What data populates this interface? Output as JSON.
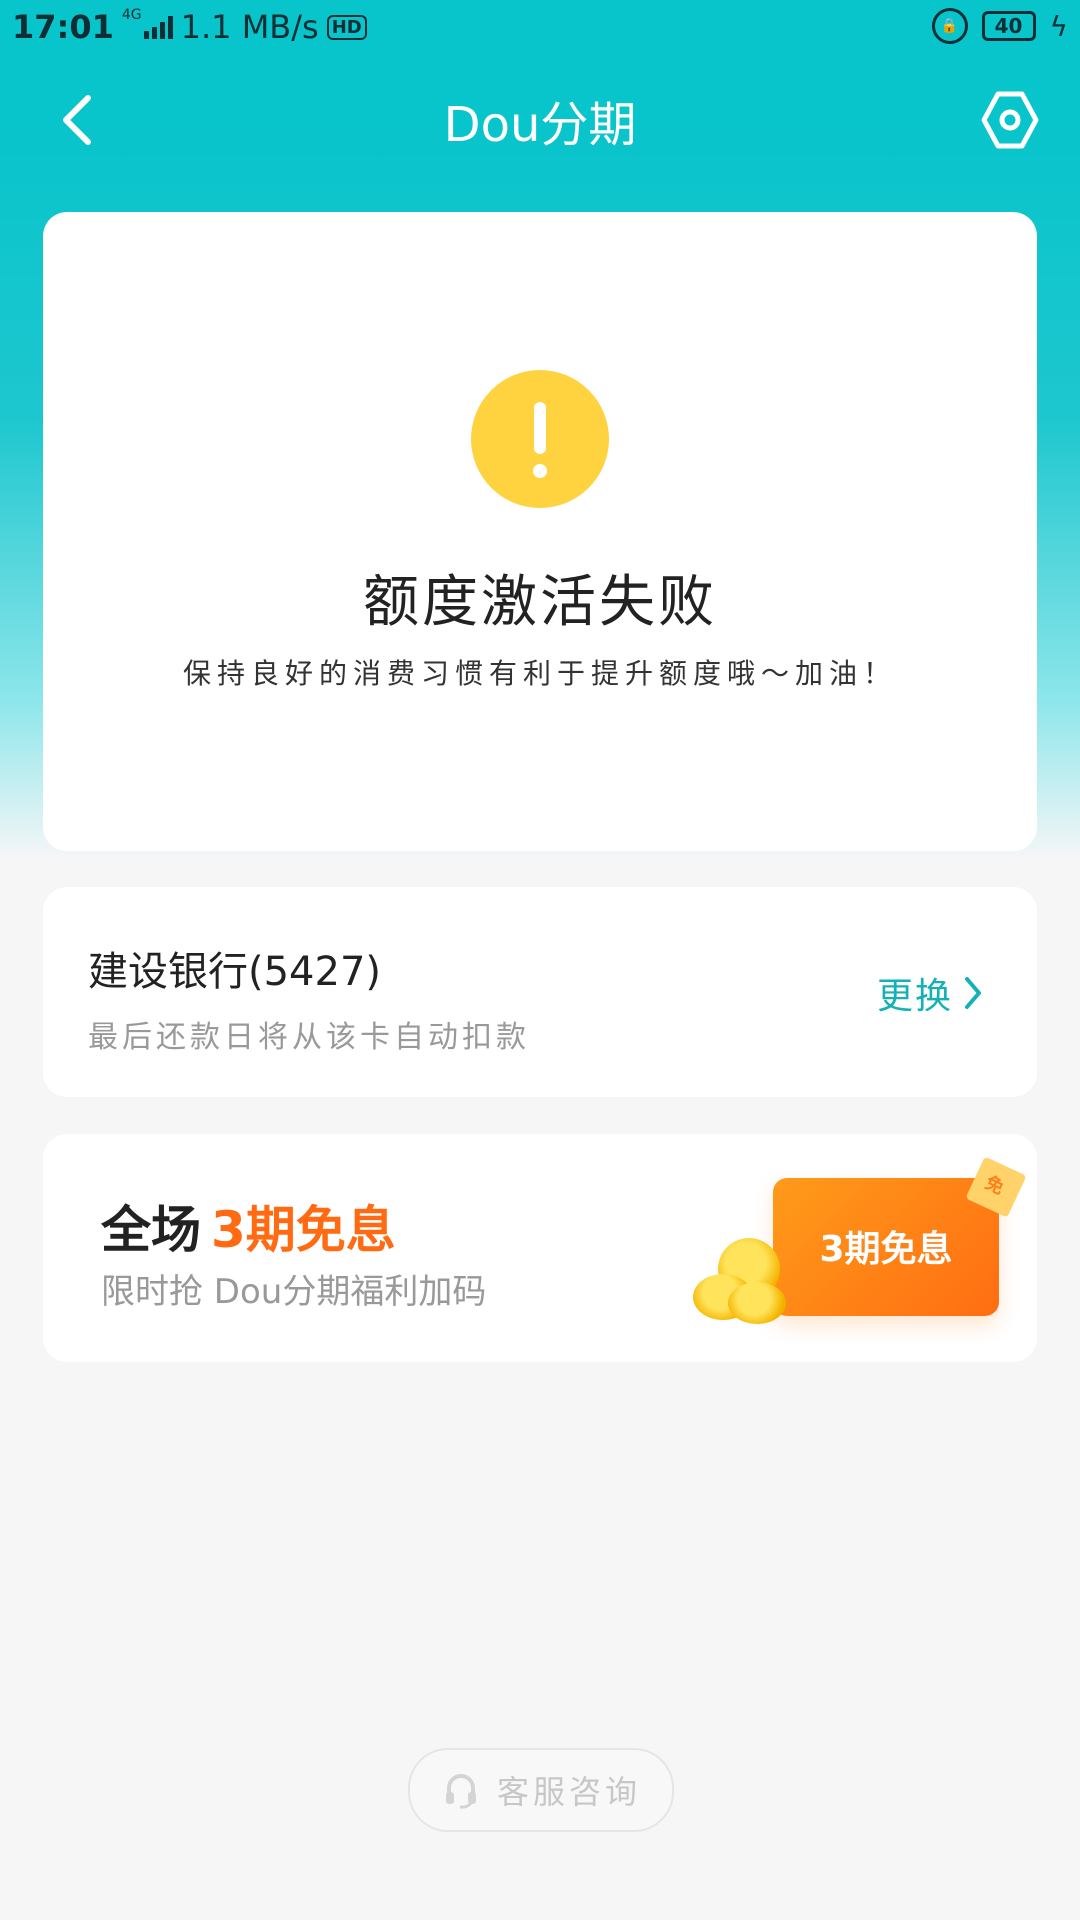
{
  "status_bar": {
    "time": "17:01",
    "network_small": "4G",
    "speed": "1.1 MB/s",
    "hd": "HD",
    "battery": "40"
  },
  "nav": {
    "title": "Dou分期"
  },
  "status_card": {
    "title": "额度激活失败",
    "subtitle": "保持良好的消费习惯有利于提升额度哦～加油！"
  },
  "bank_card": {
    "bank_name": "建设银行(5427)",
    "note": "最后还款日将从该卡自动扣款",
    "change_label": "更换"
  },
  "promo_card": {
    "title_prefix": "全场",
    "title_highlight": "3期免息",
    "subtitle": "限时抢 Dou分期福利加码",
    "art_text": "3期免息",
    "coupon_text": "免"
  },
  "footer": {
    "service_label": "客服咨询"
  },
  "colors": {
    "teal": "#08c4cb",
    "accent_teal": "#15b1b7",
    "warning": "#fed33f",
    "promo_orange": "#ff6a13"
  }
}
